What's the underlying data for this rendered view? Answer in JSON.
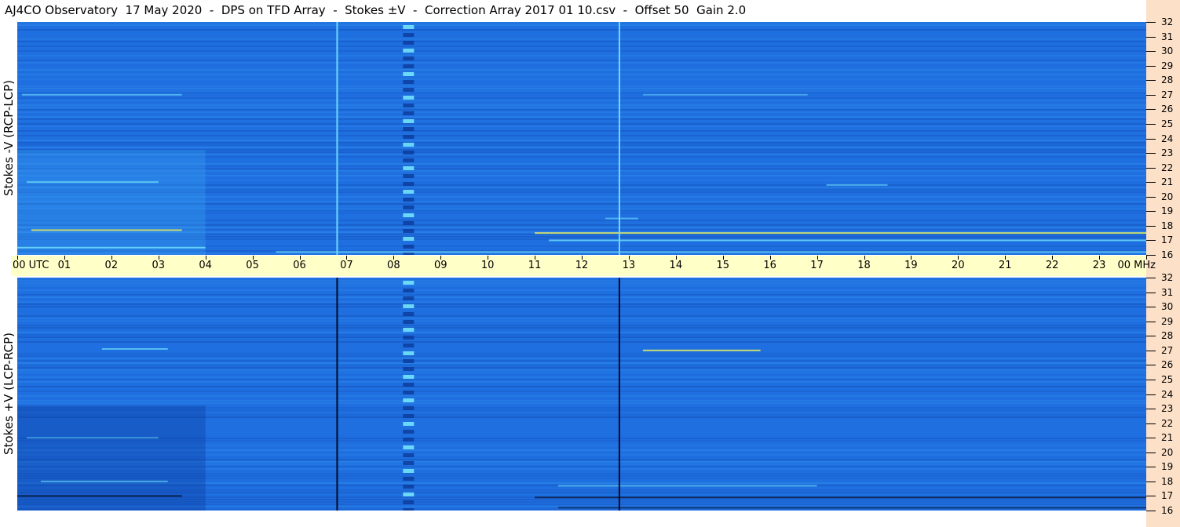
{
  "title": "AJ4CO Observatory  17 May 2020  -  DPS on TFD Array  -  Stokes ±V  -  Correction Array 2017 01 10.csv  -  Offset 50  Gain 2.0",
  "colors": {
    "background": "#ffffff",
    "time_axis_bar": "#ffffc8",
    "freq_axis_strip": "#fce0c8",
    "spectrogram_base": "#1f6fe0",
    "spectrogram_dark": "#0b3a9a",
    "spectrogram_light": "#3aa0f0",
    "hot_cyan": "#7ef3ff",
    "hot_yellow": "#f2f55a",
    "dark_band": "#0a1030"
  },
  "chart_data": [
    {
      "type": "heatmap",
      "name": "top-panel",
      "ylabel": "Stokes -V (RCP-LCP)",
      "x_unit": "UTC",
      "y_unit": "MHz",
      "xlim": [
        0,
        24
      ],
      "ylim": [
        16,
        32
      ],
      "vertical_lines_utc": [
        6.8,
        12.8
      ],
      "vertical_line_color": "#6fd8ff",
      "interference_column_utc": 8.3,
      "horizontal_streaks": [
        {
          "mhz": 27.0,
          "x0": 0.1,
          "x1": 3.5,
          "strength": 0.5
        },
        {
          "mhz": 27.0,
          "x0": 13.3,
          "x1": 16.8,
          "strength": 0.4
        },
        {
          "mhz": 21.0,
          "x0": 0.2,
          "x1": 3.0,
          "strength": 0.6
        },
        {
          "mhz": 20.8,
          "x0": 17.2,
          "x1": 18.5,
          "strength": 0.5
        },
        {
          "mhz": 18.5,
          "x0": 12.5,
          "x1": 13.2,
          "strength": 0.5
        },
        {
          "mhz": 17.7,
          "x0": 0.3,
          "x1": 3.5,
          "strength": 0.8
        },
        {
          "mhz": 17.5,
          "x0": 11.0,
          "x1": 24.0,
          "strength": 0.8
        },
        {
          "mhz": 17.0,
          "x0": 11.3,
          "x1": 24.0,
          "strength": 0.7
        },
        {
          "mhz": 16.5,
          "x0": 0.0,
          "x1": 4.0,
          "strength": 0.7
        },
        {
          "mhz": 16.2,
          "x0": 5.5,
          "x1": 24.0,
          "strength": 0.6
        }
      ]
    },
    {
      "type": "heatmap",
      "name": "bottom-panel",
      "ylabel": "Stokes +V (LCP-RCP)",
      "x_unit": "UTC",
      "y_unit": "MHz",
      "xlim": [
        0,
        24
      ],
      "ylim": [
        16,
        32
      ],
      "vertical_lines_utc": [
        6.8,
        12.8
      ],
      "vertical_line_color": "#050a25",
      "interference_column_utc": 8.3,
      "horizontal_streaks": [
        {
          "mhz": 27.1,
          "x0": 1.8,
          "x1": 3.2,
          "strength": 0.6
        },
        {
          "mhz": 27.0,
          "x0": 13.3,
          "x1": 15.8,
          "strength": 0.8
        },
        {
          "mhz": 21.0,
          "x0": 0.2,
          "x1": 3.0,
          "strength": 0.4
        },
        {
          "mhz": 18.0,
          "x0": 0.5,
          "x1": 3.2,
          "strength": 0.5
        },
        {
          "mhz": 17.7,
          "x0": 11.5,
          "x1": 17.0,
          "strength": 0.5
        },
        {
          "mhz": 17.0,
          "x0": 0.0,
          "x1": 3.5,
          "strength": -0.8
        },
        {
          "mhz": 16.9,
          "x0": 11.0,
          "x1": 24.0,
          "strength": -0.7
        },
        {
          "mhz": 16.2,
          "x0": 11.5,
          "x1": 24.0,
          "strength": -0.6
        }
      ]
    }
  ],
  "time_axis": {
    "first_label": "00  UTC",
    "last_label": "00 MHz",
    "ticks": [
      "01",
      "02",
      "03",
      "04",
      "05",
      "06",
      "07",
      "08",
      "09",
      "10",
      "11",
      "12",
      "13",
      "14",
      "15",
      "16",
      "17",
      "18",
      "19",
      "20",
      "21",
      "22",
      "23"
    ]
  },
  "freq_axis": {
    "labels": [
      "32",
      "31",
      "30",
      "29",
      "28",
      "27",
      "26",
      "25",
      "24",
      "23",
      "22",
      "21",
      "20",
      "19",
      "18",
      "17",
      "16"
    ]
  }
}
